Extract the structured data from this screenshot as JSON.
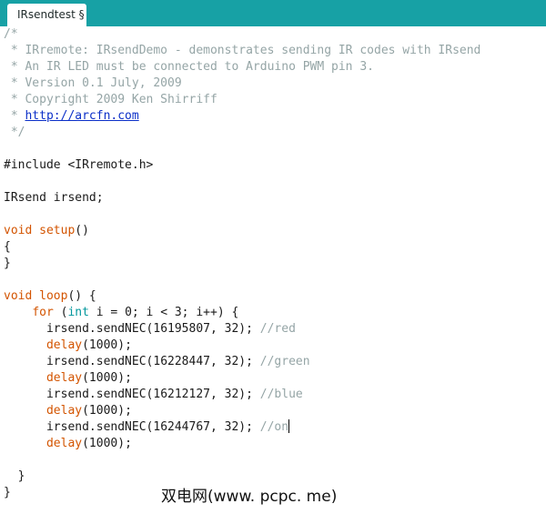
{
  "tab": {
    "title": "IRsendtest §"
  },
  "code": {
    "c1": "/*",
    "c2": " * IRremote: IRsendDemo - demonstrates sending IR codes with IRsend",
    "c3": " * An IR LED must be connected to Arduino PWM pin 3.",
    "c4": " * Version 0.1 July, 2009",
    "c5": " * Copyright 2009 Ken Shirriff",
    "c6_prefix": " * ",
    "c6_link": "http://arcfn.com",
    "c7": " */",
    "include": "#include <IRremote.h>",
    "decl": "IRsend irsend;",
    "setup_kw": "void",
    "setup_fn": "setup",
    "setup_rest": "()",
    "open_brace": "{",
    "close_brace": "}",
    "loop_kw": "void",
    "loop_fn": "loop",
    "loop_rest": "() {",
    "for_indent": "    ",
    "for_kw": "for",
    "for_open": " (",
    "for_type": "int",
    "for_rest": " i = 0; i < 3; i++) {",
    "send1": "irsend.sendNEC(16195807, 32); ",
    "send1_comment": "//red",
    "delay_fn": "delay",
    "delay_args": "(1000);",
    "send2": "irsend.sendNEC(16228447, 32); ",
    "send2_comment": "//green",
    "send3": "irsend.sendNEC(16212127, 32); ",
    "send3_comment": "//blue",
    "send4": "irsend.sendNEC(16244767, 32); ",
    "send4_comment": "//on",
    "inner_close": "  }",
    "outer_close": "}"
  },
  "watermark": "双电网(www. pcpc. me)",
  "colors": {
    "tabbar": "#17a1a5",
    "comment": "#95a5a6",
    "keyword": "#d35400",
    "type": "#00979c",
    "link": "#0b2fc8"
  }
}
